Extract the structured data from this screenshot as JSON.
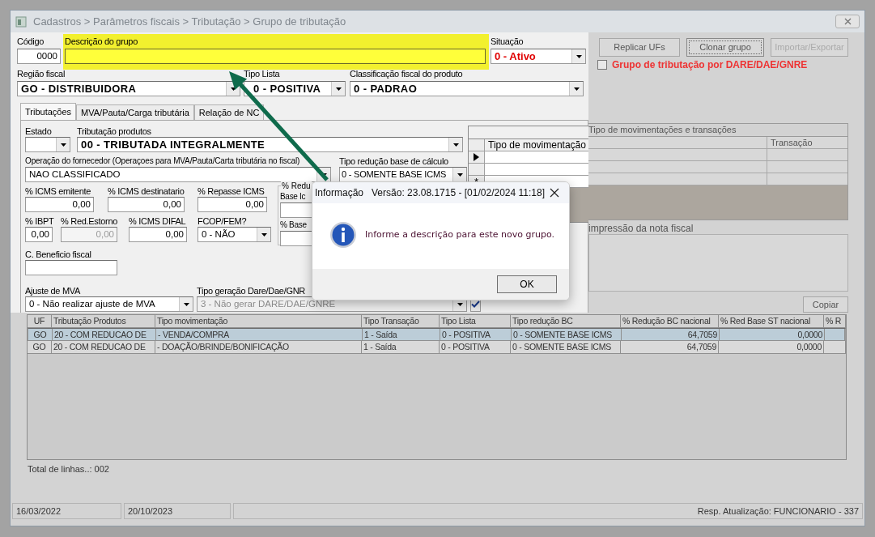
{
  "window": {
    "title": "Cadastros > Parâmetros fiscais > Tributação > Grupo de tributação"
  },
  "header": {
    "codigo": {
      "kind": "text",
      "label": "Código",
      "value": "0000"
    },
    "descricao": {
      "kind": "text",
      "label": "Descrição do grupo",
      "highlighted": true
    },
    "situacao": {
      "kind": "select",
      "label": "Situação",
      "value": "0 - Ativo"
    },
    "regiao_fiscal": {
      "kind": "select",
      "label": "Região fiscal",
      "value": "GO - DISTRIBUIDORA"
    },
    "tipo_lista": {
      "kind": "select",
      "label": "Tipo Lista",
      "value": "0 - POSITIVA"
    },
    "classificacao": {
      "kind": "select",
      "label": "Classificação fiscal do produto",
      "value": "0 - PADRAO"
    }
  },
  "tabs": [
    {
      "label": "Tributações",
      "selected": true
    },
    {
      "label": "MVA/Pauta/Carga tributária",
      "selected": false
    },
    {
      "label": "Relação de NC",
      "selected": false
    }
  ],
  "tributacoes": {
    "estado": {
      "kind": "select",
      "label": "Estado"
    },
    "tributacao_produtos": {
      "kind": "select",
      "label": "Tributação produtos",
      "value": "00 - TRIBUTADA INTEGRALMENTE"
    },
    "operacao_fornecedor": {
      "kind": "select",
      "label": "Operação do fornecedor (Operaçoes para MVA/Pauta/Carta tributária no fiscal)",
      "value": "NAO CLASSIFICADO"
    },
    "tipo_reducao": {
      "kind": "select",
      "label": "Tipo redução base de cálculo",
      "value": "0 - SOMENTE BASE ICMS"
    },
    "icms_emitente": {
      "kind": "text",
      "label": "% ICMS emitente",
      "value": "0,00"
    },
    "icms_destinatario": {
      "kind": "text",
      "label": "% ICMS destinatario",
      "value": "0,00"
    },
    "repasse_icms": {
      "kind": "text",
      "label": "% Repasse ICMS",
      "value": "0,00"
    },
    "ibpt": {
      "kind": "text",
      "label": "% IBPT",
      "value": "0,00"
    },
    "red_estorno": {
      "kind": "text",
      "label": "% Red.Estorno",
      "value": "0,00",
      "disabled": true
    },
    "icms_difal": {
      "kind": "text",
      "label": "% ICMS DIFAL",
      "value": "0,00"
    },
    "fcop_fem": {
      "kind": "select",
      "label": "FCOP/FEM?",
      "value": "0 - NÃO"
    },
    "reducao_group": {
      "title": "% Redu",
      "fields": [
        {
          "kind": "text",
          "label": "Base Ic"
        },
        {
          "kind": "text",
          "label": "% Base"
        }
      ]
    },
    "beneficio_fiscal": {
      "kind": "text",
      "label": "C. Beneficio fiscal"
    },
    "ajuste_mva": {
      "kind": "select",
      "label": "Ajuste de MVA",
      "value": "0 - Não realizar ajuste de MVA"
    },
    "tipo_geracao": {
      "kind": "select",
      "label": "Tipo geração Dare/Dae/GNR",
      "value": "3 - Não gerar DARE/DAE/GNRE",
      "disabled": true
    }
  },
  "movimentacoes": {
    "band": "Tipo de movimentações e transações",
    "columns": [
      "Tipo de movimentação",
      "Transação"
    ],
    "rows": [
      {
        "kind": "current"
      },
      {
        "kind": "blank"
      },
      {
        "kind": "new",
        "marker": "*"
      }
    ],
    "note_label": "impressão da nota fiscal"
  },
  "actions": {
    "buttons": [
      {
        "label": "Replicar UFs",
        "disabled": false,
        "focused": false
      },
      {
        "label": "Clonar grupo",
        "disabled": false,
        "focused": true
      },
      {
        "label": "Importar/Exportar",
        "disabled": true,
        "focused": false
      }
    ],
    "checkbox": {
      "label": "Grupo de tributação por DARE/DAE/GNRE",
      "checked": false
    },
    "copy_button": "Copiar"
  },
  "table": {
    "columns": [
      "UF",
      "Tributação Produtos",
      "Tipo movimentação",
      "Tipo Transação",
      "Tipo Lista",
      "Tipo redução BC",
      "% Redução BC nacional",
      "% Red Base ST nacional",
      "% R"
    ],
    "rows": [
      {
        "selected": true,
        "cells": [
          "GO",
          "20 - COM REDUCAO DE",
          "- VENDA/COMPRA",
          "1 - Saída",
          "0 - POSITIVA",
          "0 - SOMENTE BASE ICMS",
          "64,7059",
          "0,0000"
        ]
      },
      {
        "selected": false,
        "cells": [
          "GO",
          "20 - COM REDUCAO DE",
          "- DOAÇÃO/BRINDE/BONIFICAÇÃO",
          "1 - Saída",
          "0 - POSITIVA",
          "0 - SOMENTE BASE ICMS",
          "64,7059",
          "0,0000"
        ]
      }
    ],
    "total": "Total de linhas..: 002"
  },
  "status_bar": [
    "16/03/2022",
    "20/10/2023",
    "Resp. Atualização: FUNCIONARIO - 337"
  ],
  "dialog": {
    "title": "Informação   Versão: 23.08.1715 - [01/02/2024 11:18]",
    "message": "Informe a descrição para este novo grupo.",
    "button": "OK"
  }
}
